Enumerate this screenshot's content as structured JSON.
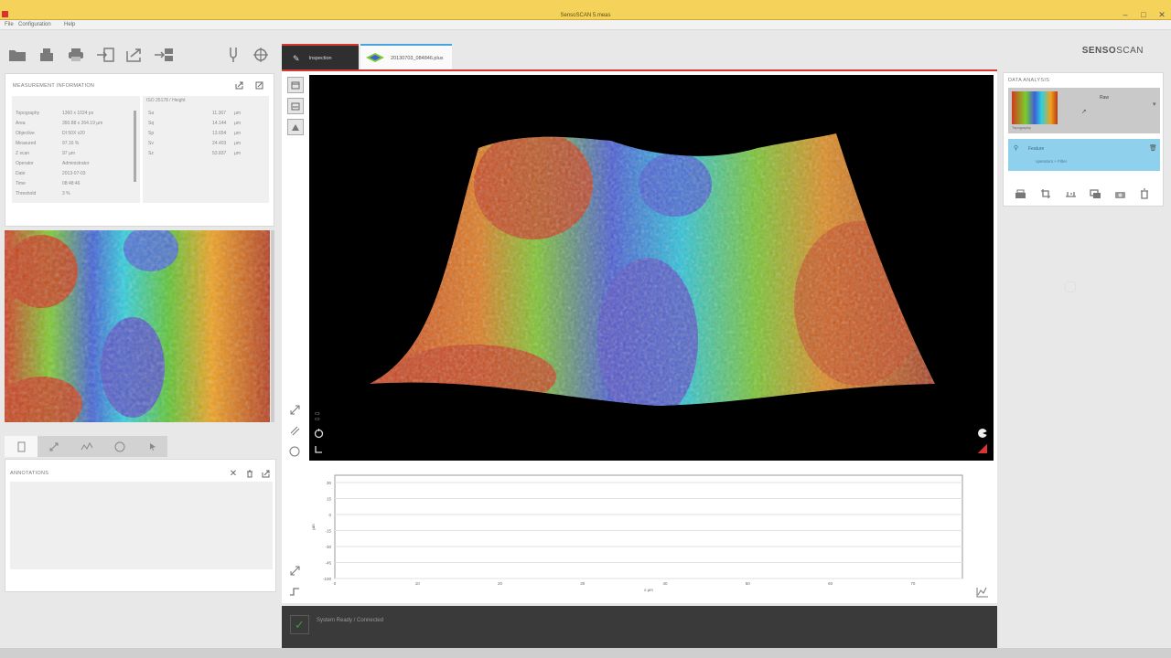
{
  "window": {
    "title": "SensoSCAN 5.meas",
    "brand_left": "SENSO",
    "brand_right": "SCAN"
  },
  "menu": [
    "File",
    "Configuration",
    "Help"
  ],
  "measurement_info": {
    "title": "MEASUREMENT INFORMATION",
    "rows": [
      {
        "label": "Topography",
        "value": "1360 x 1024 px"
      },
      {
        "label": "Area",
        "value": "350.88 x 264.19 µm"
      },
      {
        "label": "Objective",
        "value": "DI 50X v20"
      },
      {
        "label": "Measured",
        "value": "97.16 %"
      },
      {
        "label": "Z scan",
        "value": "97 µm"
      },
      {
        "label": "Operator",
        "value": "Administrator"
      },
      {
        "label": "Date",
        "value": "2013-07-03"
      },
      {
        "label": "Time",
        "value": "08:48:46"
      },
      {
        "label": "Threshold",
        "value": "3 %"
      }
    ],
    "params_title": "ISO 25178 / Height",
    "params": [
      {
        "label": "Sa",
        "value": "11.367",
        "unit": "µm"
      },
      {
        "label": "Sq",
        "value": "14.144",
        "unit": "µm"
      },
      {
        "label": "Sp",
        "value": "13.654",
        "unit": "µm"
      },
      {
        "label": "Sv",
        "value": "24.403",
        "unit": "µm"
      },
      {
        "label": "Sz",
        "value": "53.837",
        "unit": "µm"
      }
    ]
  },
  "annotations": {
    "title": "ANNOTATIONS"
  },
  "tabs": [
    {
      "label": "Inspection",
      "active": true
    },
    {
      "label": "20130703_084846.plux",
      "active": false
    }
  ],
  "profile_chart": {
    "y_ticks": [
      "30",
      "15",
      "0",
      "-15",
      "-30",
      "-45",
      "-100"
    ],
    "x_ticks": [
      "0",
      "10",
      "20",
      "30",
      "40",
      "50",
      "60",
      "70"
    ],
    "xlabel": "x µm",
    "ylabel": "µm"
  },
  "status": {
    "text": "System Ready / Connected"
  },
  "data_analysis": {
    "title": "DATA ANALYSIS",
    "item1_title": "Raw",
    "item1_sub": "Topography",
    "item2_title": "Feature",
    "item2_sub": "operators + Filter"
  }
}
